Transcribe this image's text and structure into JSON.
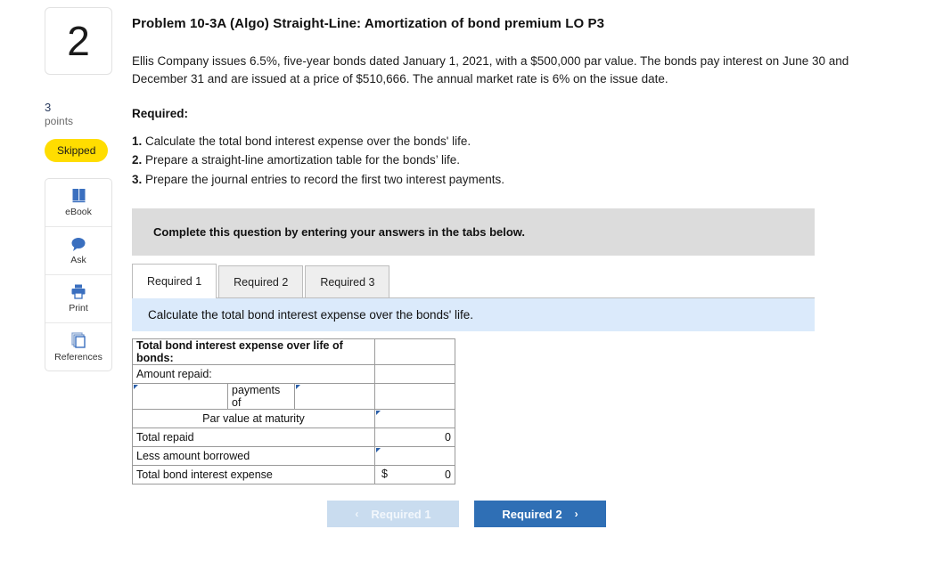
{
  "question": {
    "number": "2",
    "points_value": "3",
    "points_label": "points",
    "status_badge": "Skipped"
  },
  "tools": [
    {
      "name": "ebook",
      "label": "eBook",
      "icon": "book-icon"
    },
    {
      "name": "ask",
      "label": "Ask",
      "icon": "chat-bubble-icon"
    },
    {
      "name": "print",
      "label": "Print",
      "icon": "printer-icon"
    },
    {
      "name": "references",
      "label": "References",
      "icon": "pages-stack-icon"
    }
  ],
  "problem": {
    "title": "Problem 10-3A (Algo) Straight-Line: Amortization of bond premium LO P3",
    "statement": "Ellis Company issues 6.5%, five-year bonds dated January 1, 2021, with a $500,000 par value. The bonds pay interest on June 30 and December 31 and are issued at a price of $510,666. The annual market rate is 6% on the issue date.",
    "required_heading": "Required:",
    "requirements": [
      {
        "num": "1.",
        "text": "Calculate the total bond interest expense over the bonds' life."
      },
      {
        "num": "2.",
        "text": "Prepare a straight-line amortization table for the bonds’ life."
      },
      {
        "num": "3.",
        "text": "Prepare the journal entries to record the first two interest payments."
      }
    ]
  },
  "instruction_bar": "Complete this question by entering your answers in the tabs below.",
  "tabs": [
    {
      "label": "Required 1",
      "active": true
    },
    {
      "label": "Required 2",
      "active": false
    },
    {
      "label": "Required 3",
      "active": false
    }
  ],
  "tab_banner": "Calculate the total bond interest expense over the bonds' life.",
  "answer_table": {
    "header": "Total bond interest expense over life of bonds:",
    "rows": {
      "amount_repaid_label": "Amount repaid:",
      "payments_of_label": "payments of",
      "par_value_label": "Par value at maturity",
      "total_repaid_label": "Total repaid",
      "total_repaid_value": "0",
      "less_borrowed_label": "Less amount borrowed",
      "total_expense_label": "Total bond interest expense",
      "total_expense_currency": "$",
      "total_expense_value": "0"
    },
    "empty_value": ""
  },
  "nav": {
    "prev_label": "Required 1",
    "prev_chevron": "‹",
    "next_label": "Required 2",
    "next_chevron": "›"
  },
  "colors": {
    "table_header_blue": "#7fb0e0",
    "banner_blue": "#dbeafb",
    "instruction_gray": "#dcdcdc",
    "skipped_yellow": "#ffdd00",
    "next_button_blue": "#2f6fb5",
    "prev_button_blue": "#c9dcef",
    "icon_blue": "#3a6fbf",
    "field_border_blue": "#4a7ebb"
  }
}
